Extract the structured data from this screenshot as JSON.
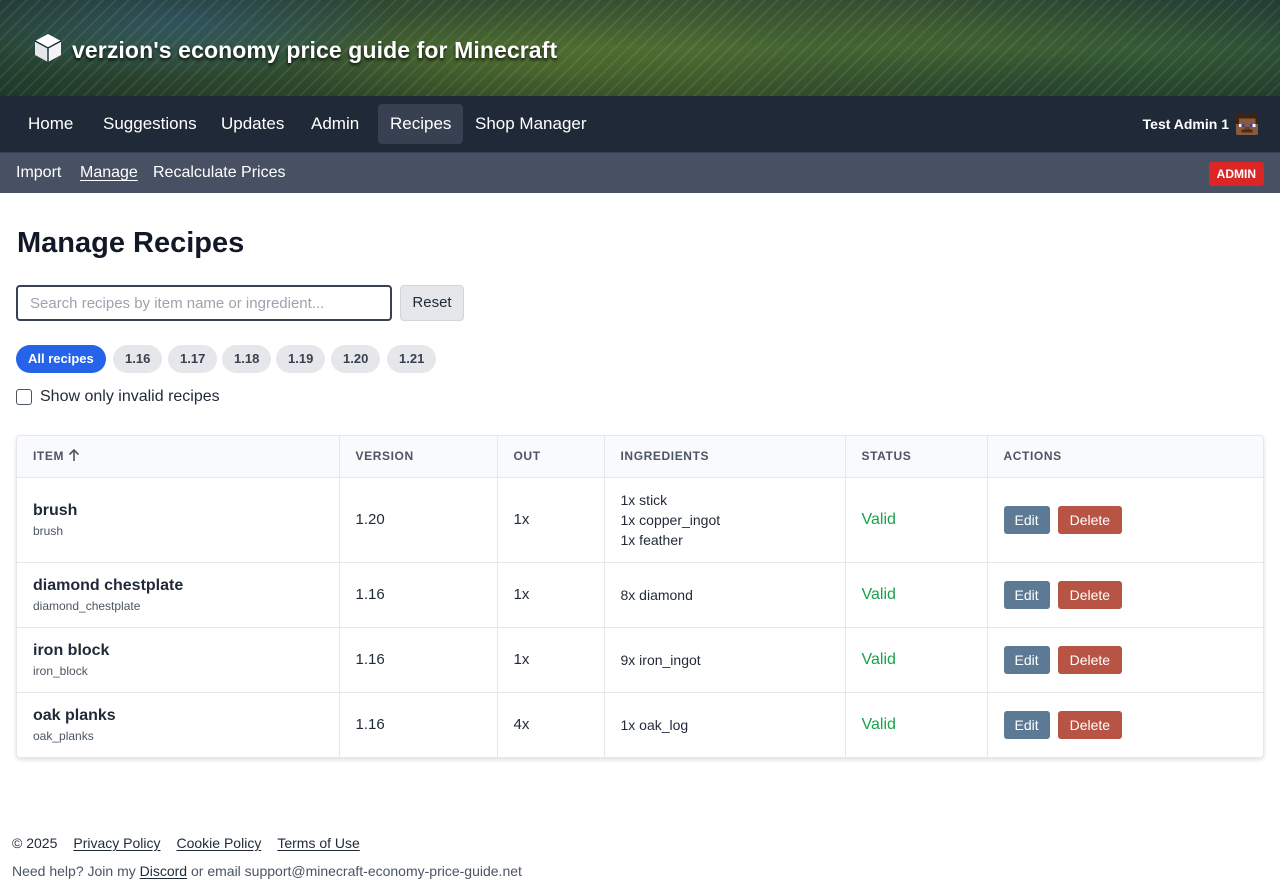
{
  "brand": {
    "title": "verzion's economy price guide for Minecraft",
    "icon": "cube-icon"
  },
  "nav": {
    "items": [
      {
        "label": "Home"
      },
      {
        "label": "Suggestions"
      },
      {
        "label": "Updates"
      },
      {
        "label": "Admin"
      },
      {
        "label": "Recipes",
        "active": true
      },
      {
        "label": "Shop Manager"
      }
    ],
    "user_name": "Test Admin 1",
    "avatar_icon": "player-head-icon"
  },
  "subnav": {
    "items": [
      {
        "label": "Import"
      },
      {
        "label": "Manage",
        "active": true
      },
      {
        "label": "Recalculate Prices"
      }
    ],
    "badge": "ADMIN"
  },
  "page": {
    "title": "Manage Recipes"
  },
  "search": {
    "placeholder": "Search recipes by item name or ingredient...",
    "value": "",
    "reset_label": "Reset"
  },
  "filters": {
    "versions": [
      {
        "label": "All recipes",
        "active": true
      },
      {
        "label": "1.16"
      },
      {
        "label": "1.17"
      },
      {
        "label": "1.18"
      },
      {
        "label": "1.19"
      },
      {
        "label": "1.20"
      },
      {
        "label": "1.21"
      }
    ],
    "invalid_only_label": "Show only invalid recipes",
    "invalid_only_checked": false
  },
  "table": {
    "columns": [
      "ITEM",
      "VERSION",
      "OUT",
      "INGREDIENTS",
      "STATUS",
      "ACTIONS"
    ],
    "sort_icon": "arrow-up-icon",
    "edit_label": "Edit",
    "delete_label": "Delete",
    "rows": [
      {
        "name": "brush",
        "id": "brush",
        "version": "1.20",
        "out": "1x",
        "ingredients": [
          "1x stick",
          "1x copper_ingot",
          "1x feather"
        ],
        "status": "Valid"
      },
      {
        "name": "diamond chestplate",
        "id": "diamond_chestplate",
        "version": "1.16",
        "out": "1x",
        "ingredients": [
          "8x diamond"
        ],
        "status": "Valid"
      },
      {
        "name": "iron block",
        "id": "iron_block",
        "version": "1.16",
        "out": "1x",
        "ingredients": [
          "9x iron_ingot"
        ],
        "status": "Valid"
      },
      {
        "name": "oak planks",
        "id": "oak_planks",
        "version": "1.16",
        "out": "4x",
        "ingredients": [
          "1x oak_log"
        ],
        "status": "Valid"
      }
    ]
  },
  "footer": {
    "copyright": "© 2025",
    "links": [
      "Privacy Policy",
      "Cookie Policy",
      "Terms of Use"
    ],
    "help_prefix": "Need help? Join my",
    "discord_label": "Discord",
    "help_suffix": "or email support@minecraft-economy-price-guide.net"
  },
  "colors": {
    "nav_bg": "#1f2937",
    "subnav_bg": "#475163",
    "accent_blue": "#2563eb",
    "admin_red": "#dc2626",
    "status_valid": "#16a34a",
    "edit_btn": "#5d7a95",
    "delete_btn": "#b85444"
  }
}
